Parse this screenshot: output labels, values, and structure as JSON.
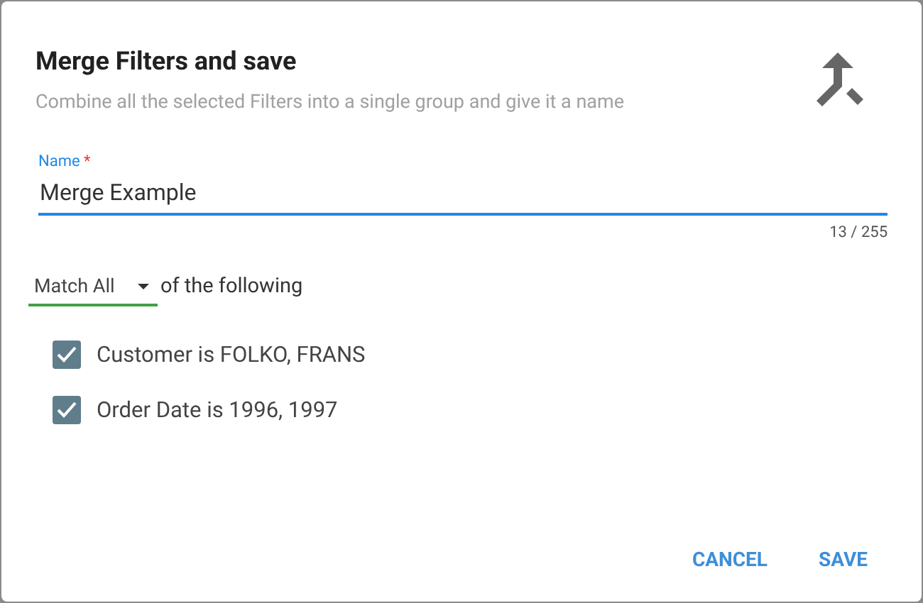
{
  "dialog": {
    "title": "Merge Filters and save",
    "subtitle": "Combine all the selected Filters into a single group and give it a name"
  },
  "name_field": {
    "label": "Name",
    "required_mark": "*",
    "value": "Merge Example",
    "counter": "13 / 255"
  },
  "match": {
    "value": "Match All",
    "suffix": "of the following"
  },
  "filters": [
    {
      "label": "Customer is FOLKO, FRANS",
      "checked": true
    },
    {
      "label": "Order Date is 1996, 1997",
      "checked": true
    }
  ],
  "buttons": [
    "CANCEL",
    "SAVE"
  ]
}
